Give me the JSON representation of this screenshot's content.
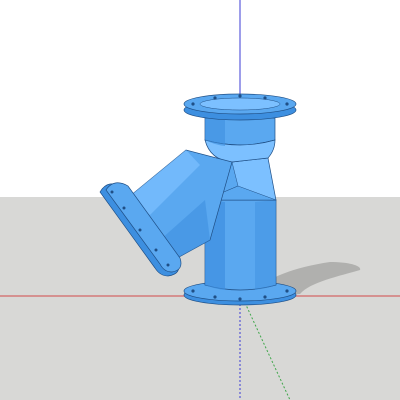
{
  "viewport": {
    "title": "",
    "model": {
      "object_icon": "y-strainer-pipe-fitting-icon",
      "color": "#5aa8f0",
      "shade_color": "#3d8fe0",
      "light_color": "#7cc0ff",
      "edge_color": "#1f4f86"
    },
    "scene": {
      "sky_color": "#ffffff",
      "ground_color": "#d8d8d6",
      "shadow_color": "#a9a9a7",
      "axes": {
        "red": "#d24a4a",
        "green": "#3fa64a",
        "blue": "#3b3bd6"
      }
    }
  }
}
